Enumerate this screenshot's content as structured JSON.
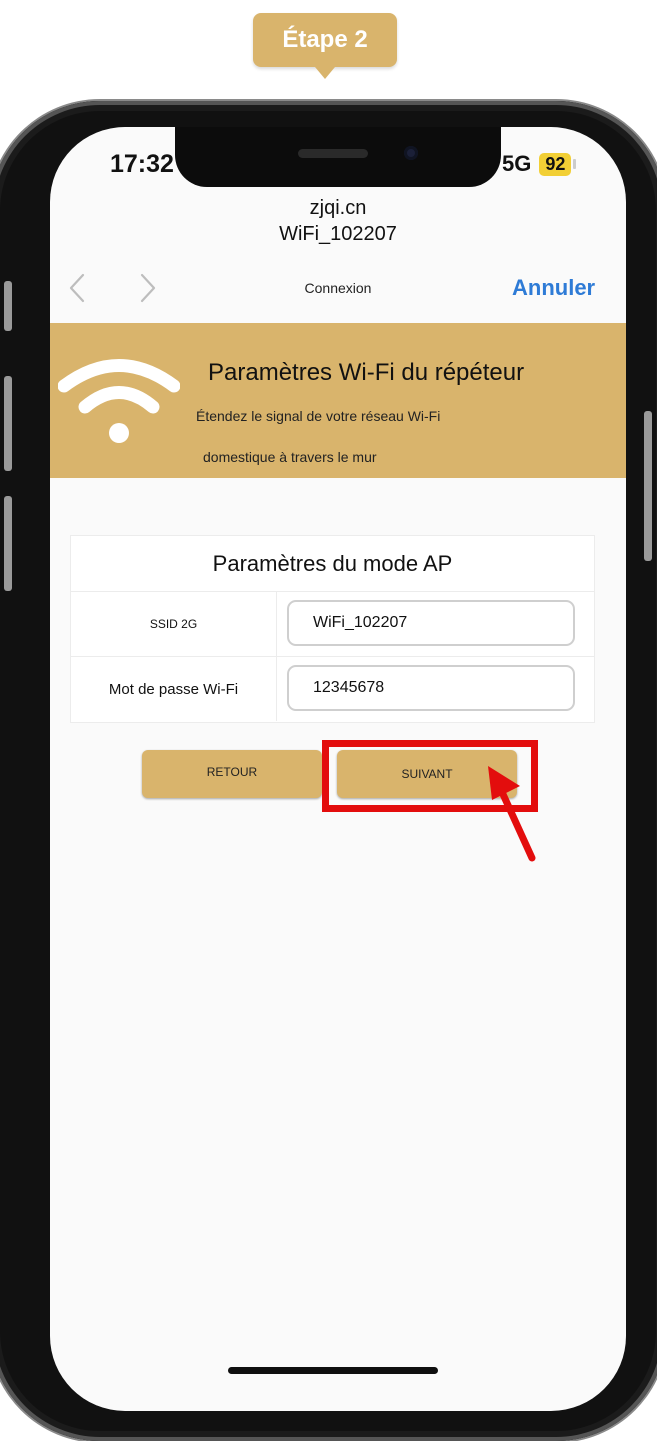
{
  "step_badge": "Étape 2",
  "status_bar": {
    "time": "17:32",
    "network": "5G",
    "battery": "92"
  },
  "browser": {
    "url_domain": "zjqi.cn",
    "url_ssid": "WiFi_102207",
    "nav_title": "Connexion",
    "cancel_label": "Annuler"
  },
  "banner": {
    "title": "Paramètres Wi-Fi du répéteur",
    "line1": "Étendez le signal de votre réseau Wi-Fi",
    "line2": "domestique à travers le mur"
  },
  "ap_settings": {
    "title": "Paramètres du mode AP",
    "ssid_label": "SSID 2G",
    "ssid_value": "WiFi_102207",
    "password_label": "Mot de passe Wi-Fi",
    "password_value": "12345678"
  },
  "buttons": {
    "back": "RETOUR",
    "next": "SUIVANT"
  },
  "colors": {
    "accent_gold": "#d9b46c",
    "link_blue": "#2e7bd6",
    "highlight_red": "#e30d0d",
    "battery_yellow": "#f2cf35"
  },
  "icons": [
    "wifi-icon",
    "chevron-left-icon",
    "chevron-right-icon",
    "red-arrow-icon"
  ]
}
